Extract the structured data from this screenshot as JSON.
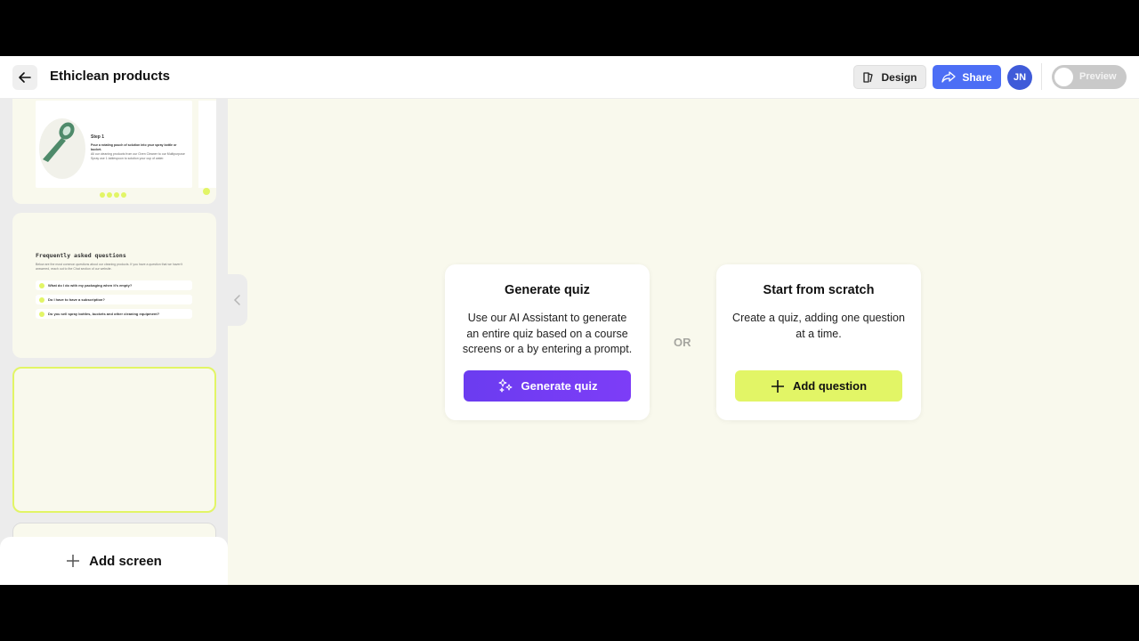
{
  "header": {
    "title": "Ethiclean products",
    "design_label": "Design",
    "share_label": "Share",
    "avatar_initials": "JN",
    "preview_label": "Preview"
  },
  "sidebar": {
    "thumb1": {
      "step_label": "Step 1",
      "text_line1": "Pour a rotating pouch of solution into your spray bottle or bucket.",
      "text_line2": "All our cleaning products from our Oven Cleaner to our Multipurpose Spray use 1 tablespoon to solution your cup of water."
    },
    "thumb2": {
      "title": "Frequently asked questions",
      "intro": "Below are the most common questions about our cleaning products. If you have a question that we haven't answered, reach out to the Chat section of our website.",
      "faqs": [
        "What do I do with my packaging when it's empty?",
        "Do I have to have a subscription?",
        "Do you sell spray bottles, buckets and other cleaning equipment?"
      ]
    },
    "add_screen_label": "Add screen"
  },
  "main": {
    "generate_card": {
      "title": "Generate quiz",
      "description": "Use our AI Assistant to generate an entire quiz based on a course screens or a by entering a prompt.",
      "button_label": "Generate quiz"
    },
    "or_label": "OR",
    "scratch_card": {
      "title": "Start from scratch",
      "description": "Create a quiz, adding one question at a time.",
      "button_label": "Add question"
    }
  },
  "colors": {
    "accent_lime": "#e2f566",
    "share_blue": "#4c6ef5",
    "generate_purple": "#6b3cf0",
    "canvas_bg": "#f9f9ed"
  }
}
